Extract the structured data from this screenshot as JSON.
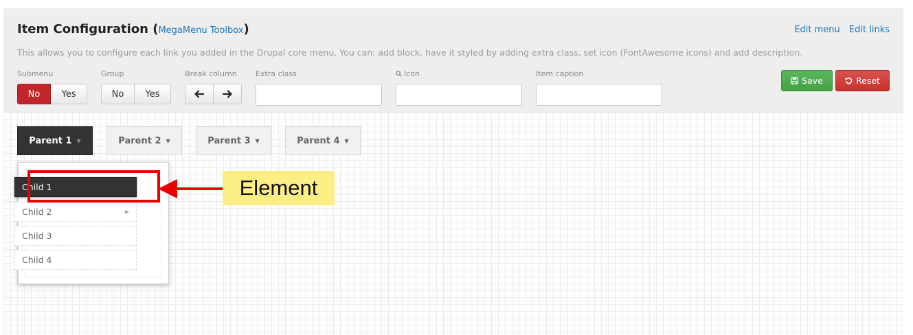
{
  "header": {
    "title": "Item Configuration (",
    "title_link": "MegaMenu Toolbox",
    "title_close": ")",
    "edit_menu": "Edit menu",
    "edit_links": "Edit links",
    "description": "This allows you to configure each link you added in the Drupal core menu. You can: add block, have it styled by adding extra class, set icon (FontAwesome icons) and add description."
  },
  "fields": {
    "submenu": {
      "label": "Submenu",
      "no": "No",
      "yes": "Yes",
      "selected": "No"
    },
    "group": {
      "label": "Group",
      "no": "No",
      "yes": "Yes"
    },
    "break_column": {
      "label": "Break column",
      "left": "🡐",
      "right": "🡒"
    },
    "extra_class": {
      "label": "Extra class",
      "value": ""
    },
    "icon": {
      "label": "Icon",
      "value": ""
    },
    "item_caption": {
      "label": "Item caption",
      "value": ""
    }
  },
  "actions": {
    "save": "Save",
    "reset": "Reset"
  },
  "menu": {
    "parents": [
      "Parent 1",
      "Parent 2",
      "Parent 3",
      "Parent 4"
    ],
    "active_parent": "Parent 1",
    "children": [
      "Child 1",
      "Child 2",
      "Child 3",
      "Child 4"
    ],
    "active_child": "Child 1"
  },
  "annotation": {
    "callout": "Element"
  },
  "colors": {
    "accent_link": "#1a73b7",
    "active_red": "#c0262a",
    "save_green": "#5cb85c",
    "reset_red": "#d9534f",
    "highlight": "#ee0000",
    "callout_bg": "#fdee83",
    "active_dark": "#333333"
  }
}
